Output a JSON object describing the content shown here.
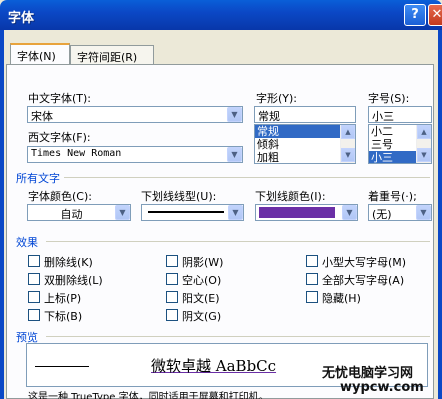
{
  "window": {
    "title": "字体",
    "help_glyph": "?",
    "close_glyph": "✕"
  },
  "tabs": [
    {
      "label": "字体(N)",
      "active": true
    },
    {
      "label": "字符间距(R)",
      "active": false
    }
  ],
  "font": {
    "cn_label": "中文字体(T):",
    "cn_value": "宋体",
    "west_label": "西文字体(F):",
    "west_value": "Times New Roman",
    "style_label": "字形(Y):",
    "style_value": "常规",
    "style_options": [
      "常规",
      "倾斜",
      "加粗"
    ],
    "style_selected": 0,
    "size_label": "字号(S):",
    "size_value": "小三",
    "size_options": [
      "小二",
      "三号",
      "小三"
    ],
    "size_selected": 2
  },
  "all_text": {
    "group_label": "所有文字",
    "color_label": "字体颜色(C):",
    "color_value": "自动",
    "underline_type_label": "下划线线型(U):",
    "underline_color_label": "下划线颜色(I):",
    "underline_color": "#6b2fa6",
    "emphasis_label": "着重号(·);",
    "emphasis_value": "(无)"
  },
  "effects": {
    "group_label": "效果",
    "col1": [
      "删除线(K)",
      "双删除线(L)",
      "上标(P)",
      "下标(B)"
    ],
    "col2": [
      "阴影(W)",
      "空心(O)",
      "阳文(E)",
      "阴文(G)"
    ],
    "col3": [
      "小型大写字母(M)",
      "全部大写字母(A)",
      "隐藏(H)"
    ]
  },
  "preview": {
    "group_label": "预览",
    "sample": "微软卓越 AaBbCc",
    "note": "这是一种 TrueType 字体，同时适用于屏幕和打印机。"
  },
  "watermark": {
    "line1": "无忧电脑学习网",
    "line2": "wypcw.com"
  }
}
